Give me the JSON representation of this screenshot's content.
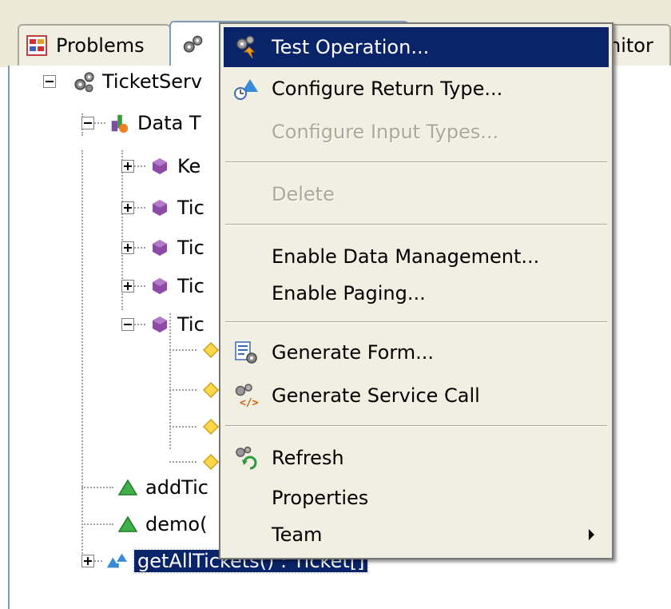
{
  "tabs": [
    {
      "label": "Problems",
      "icon": "problems-icon",
      "active": false
    },
    {
      "label": "",
      "icon": "services-gear-icon",
      "active": true
    },
    {
      "label": "nitor",
      "icon": "",
      "active": false
    }
  ],
  "tree": {
    "root": {
      "label": "TicketServ",
      "icon": "service-gears-icon"
    },
    "data_types": {
      "label": "Data T",
      "icon": "data-types-icon"
    },
    "types": [
      "Ke",
      "Tic",
      "Tic",
      "Tic",
      "Tic"
    ],
    "operations": [
      {
        "label": "addTic",
        "icon": "operation-triangle-icon"
      },
      {
        "label": "demo(",
        "icon": "operation-triangle-icon"
      },
      {
        "label": "getAllTickets() : Ticket[]",
        "icon": "operation-return-icon",
        "selected": true
      }
    ]
  },
  "menu": {
    "items": [
      {
        "label": "Test Operation...",
        "icon": "test-operation-icon",
        "highlighted": true,
        "disabled": false
      },
      {
        "label": "Configure Return Type...",
        "icon": "configure-return-icon",
        "highlighted": false,
        "disabled": false
      },
      {
        "label": "Configure Input Types...",
        "icon": "",
        "highlighted": false,
        "disabled": true
      },
      {
        "label": "Delete",
        "icon": "",
        "highlighted": false,
        "disabled": true
      },
      {
        "label": "Enable Data Management...",
        "icon": "",
        "highlighted": false,
        "disabled": false
      },
      {
        "label": "Enable Paging...",
        "icon": "",
        "highlighted": false,
        "disabled": false
      },
      {
        "label": "Generate Form...",
        "icon": "generate-form-icon",
        "highlighted": false,
        "disabled": false
      },
      {
        "label": "Generate Service Call",
        "icon": "generate-service-call-icon",
        "highlighted": false,
        "disabled": false
      },
      {
        "label": "Refresh",
        "icon": "refresh-icon",
        "highlighted": false,
        "disabled": false
      },
      {
        "label": "Properties",
        "icon": "",
        "highlighted": false,
        "disabled": false
      },
      {
        "label": "Team",
        "icon": "",
        "highlighted": false,
        "disabled": false,
        "submenu": true
      }
    ]
  },
  "colors": {
    "selection": "#0a246a",
    "menu_bg": "#f1efe2",
    "disabled_text": "#aca899"
  }
}
